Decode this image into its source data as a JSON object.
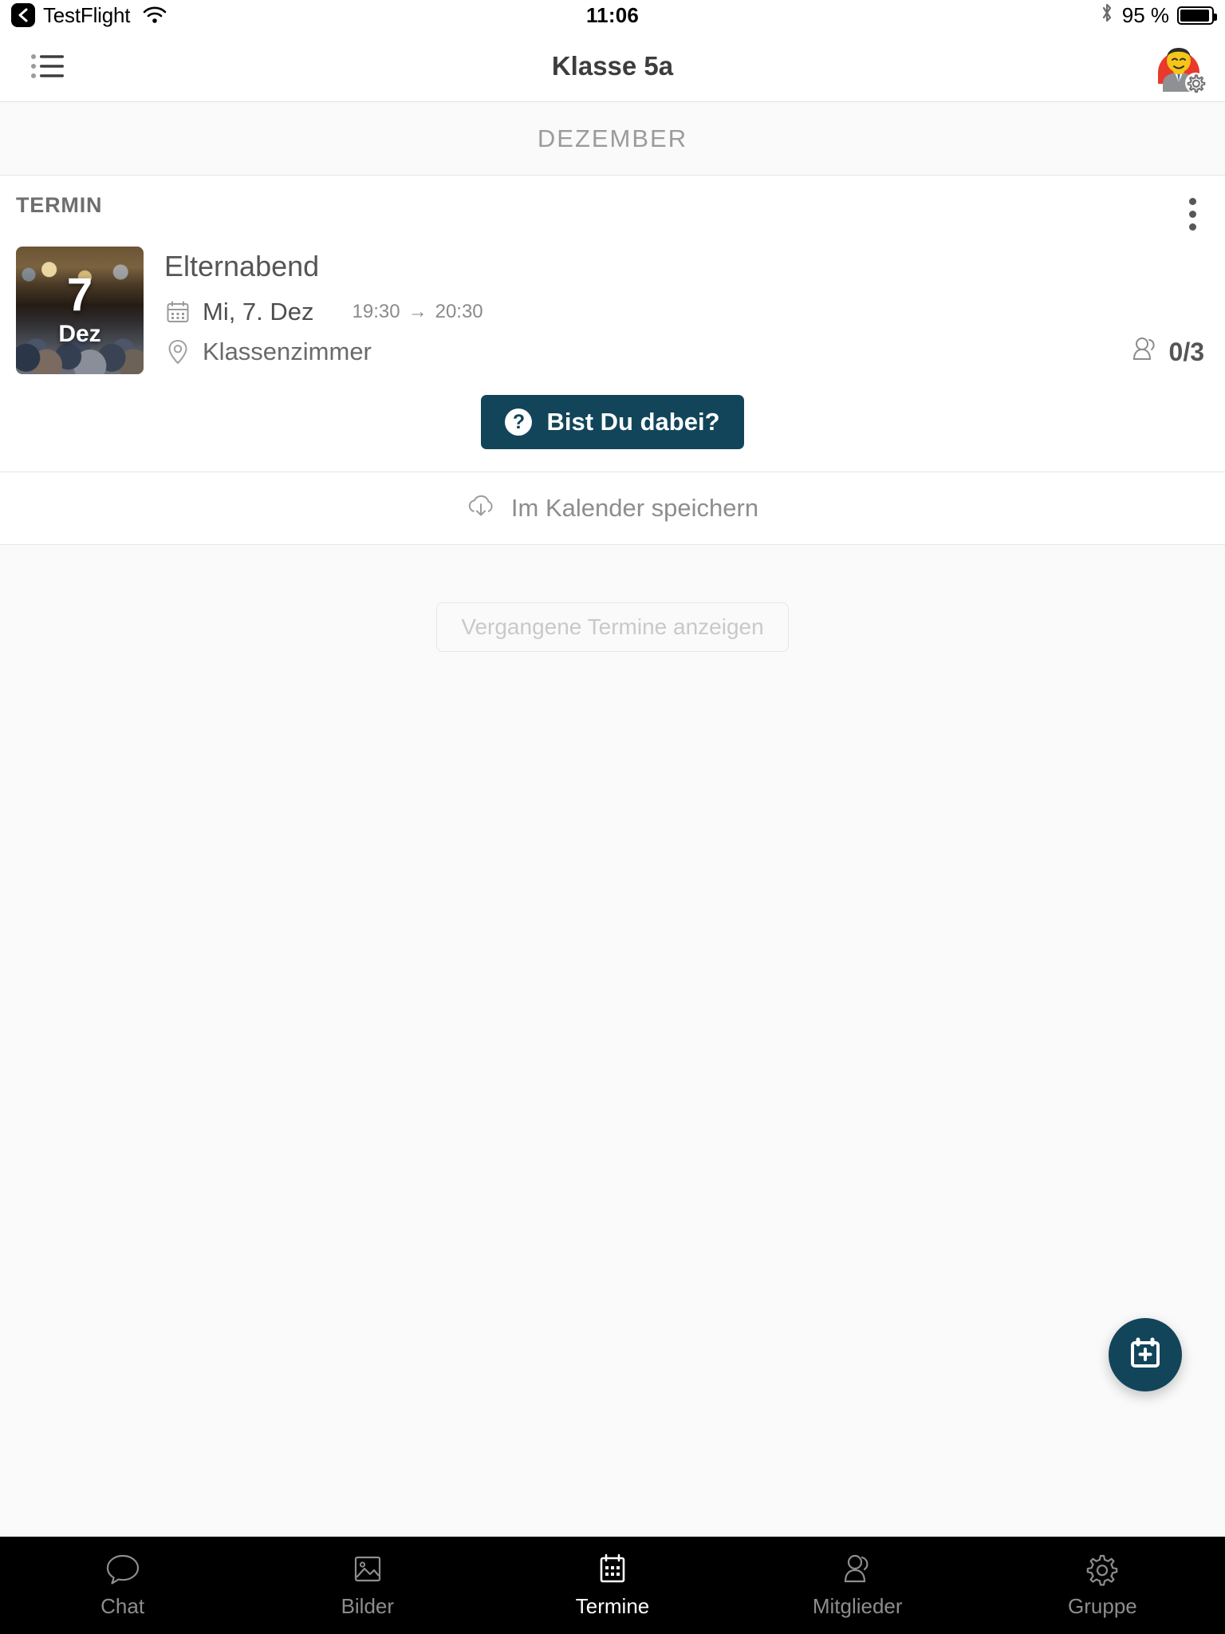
{
  "statusbar": {
    "back_app": "TestFlight",
    "back_icon": "chevron-left-icon",
    "wifi_icon": "wifi-icon",
    "time": "11:06",
    "bluetooth_icon": "bluetooth-icon",
    "battery_text": "95 %",
    "battery_percent": 95
  },
  "navbar": {
    "menu_icon": "list-menu-icon",
    "title": "Klasse 5a",
    "avatar_icon": "user-avatar-with-gear-icon"
  },
  "month_header": {
    "label": "DEZEMBER"
  },
  "event": {
    "kind_label": "TERMIN",
    "more_icon": "kebab-menu-icon",
    "thumb_day": "7",
    "thumb_month": "Dez",
    "title": "Elternabend",
    "calendar_icon": "calendar-icon",
    "date_text": "Mi, 7. Dez",
    "time_start": "19:30",
    "time_arrow": "→",
    "time_end": "20:30",
    "location_icon": "map-pin-icon",
    "location_text": "Klassenzimmer",
    "attendees_icon": "people-icon",
    "attendees_text": "0/3",
    "cta_icon": "question-mark-icon",
    "cta_label": "Bist Du dabei?",
    "save_icon": "cloud-download-icon",
    "save_label": "Im Kalender speichern"
  },
  "past_events": {
    "button_label": "Vergangene Termine anzeigen"
  },
  "fab": {
    "icon": "calendar-plus-icon"
  },
  "tabbar": {
    "items": [
      {
        "label": "Chat",
        "icon": "speech-bubble-icon",
        "active": false
      },
      {
        "label": "Bilder",
        "icon": "photo-icon",
        "active": false
      },
      {
        "label": "Termine",
        "icon": "calendar-icon",
        "active": true
      },
      {
        "label": "Mitglieder",
        "icon": "person-icon",
        "active": false
      },
      {
        "label": "Gruppe",
        "icon": "gear-icon",
        "active": false
      }
    ]
  },
  "colors": {
    "accent": "#12455a",
    "tabbar_bg": "#000000",
    "page_bg": "#fafafa",
    "card_bg": "#ffffff",
    "muted_text": "#8d8d8d"
  }
}
